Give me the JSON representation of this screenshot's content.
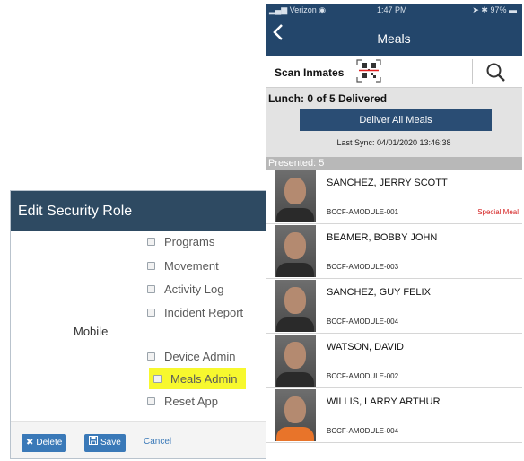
{
  "role_editor": {
    "title": "Edit Security Role",
    "group_label": "Mobile",
    "permissions": [
      {
        "label": "Programs",
        "checked": false
      },
      {
        "label": "Movement",
        "checked": false
      },
      {
        "label": "Activity Log",
        "checked": false
      },
      {
        "label": "Incident Report",
        "checked": false
      },
      {
        "label": "Device Admin",
        "checked": false
      },
      {
        "label": "Meals Admin",
        "checked": false,
        "highlighted": true
      },
      {
        "label": "Reset App",
        "checked": false
      }
    ],
    "footer": {
      "delete_label": "Delete",
      "save_label": "Save",
      "cancel_label": "Cancel"
    }
  },
  "phone": {
    "status_bar": {
      "carrier": "Verizon",
      "time": "1:47 PM",
      "battery": "97%"
    },
    "nav": {
      "title": "Meals",
      "back_icon": "chevron-left-icon"
    },
    "scan_bar": {
      "label": "Scan Inmates",
      "qr_icon": "qr-code-icon",
      "search_icon": "search-icon"
    },
    "meal_status": {
      "title": "Lunch: 0 of 5 Delivered",
      "deliver_button": "Deliver All Meals",
      "last_sync": "Last Sync: 04/01/2020 13:46:38"
    },
    "presented_label": "Presented: 5",
    "inmates": [
      {
        "name": "SANCHEZ, JERRY SCOTT",
        "location": "BCCF-AMODULE-001",
        "flag": "Special Meal"
      },
      {
        "name": "BEAMER, BOBBY JOHN",
        "location": "BCCF-AMODULE-003",
        "flag": ""
      },
      {
        "name": "SANCHEZ, GUY FELIX",
        "location": "BCCF-AMODULE-004",
        "flag": ""
      },
      {
        "name": "WATSON, DAVID",
        "location": "BCCF-AMODULE-002",
        "flag": ""
      },
      {
        "name": "WILLIS, LARRY ARTHUR",
        "location": "BCCF-AMODULE-004",
        "flag": ""
      }
    ]
  },
  "colors": {
    "header_navy": "#23466b",
    "role_header": "#2e4a62",
    "button_blue": "#3a79b8",
    "highlight_yellow": "#f7f82e",
    "special_meal_red": "#d42020"
  }
}
